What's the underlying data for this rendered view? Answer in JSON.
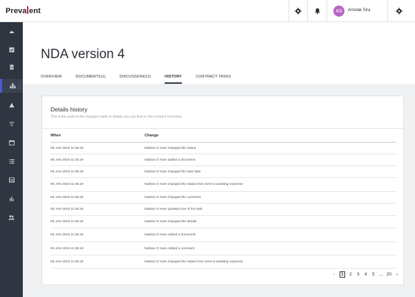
{
  "app": {
    "logo_left": "Preva",
    "logo_right": "ent"
  },
  "user": {
    "initials": "AS",
    "name": "Amolak Sira",
    "avatar_color": "#b864c4"
  },
  "sidebar": {
    "items": [
      {
        "icon": "dashboard-icon"
      },
      {
        "icon": "checkbox-icon"
      },
      {
        "icon": "document-icon"
      },
      {
        "icon": "org-chart-icon",
        "active": true
      },
      {
        "icon": "warning-icon"
      },
      {
        "icon": "filter-list-icon"
      },
      {
        "icon": "calendar-icon"
      },
      {
        "icon": "list-icon"
      },
      {
        "icon": "table-icon"
      },
      {
        "icon": "bar-chart-icon"
      },
      {
        "icon": "users-icon"
      }
    ]
  },
  "page": {
    "title": "NDA version 4",
    "tabs": [
      {
        "label": "OVERVIEW"
      },
      {
        "label": "DOCUMENTS(1)"
      },
      {
        "label": "DISCUSSION(12)"
      },
      {
        "label": "HISTORY",
        "active": true
      },
      {
        "label": "CONTRACT TASKS"
      }
    ]
  },
  "details": {
    "title": "Details history",
    "subtitle": "This is the audit of the changes made to details you can find on the contract Overview",
    "col_when": "When",
    "col_change": "Change",
    "rows": [
      {
        "when": "06 JAN 2019 11:38:19",
        "change": "Nathan O Hare changed the status"
      },
      {
        "when": "06 JAN 2019 11:38:19",
        "change": "Nathan O Hare added a document"
      },
      {
        "when": "06 JAN 2019 11:38:19",
        "change": "Nathan O Hare changed the start date"
      },
      {
        "when": "06 JAN 2019 11:38:19",
        "change": "Nathan O Hare changed the Status from Sent to awaiting response"
      },
      {
        "when": "06 JAN 2019 11:38:19",
        "change": "Nathan O Hare changed the comment"
      },
      {
        "when": "06 JAN 2019 11:38:19",
        "change": "Nathan O Hare updated one of the task"
      },
      {
        "when": "06 JAN 2019 11:38:19",
        "change": "Nathan O Hare changed the details"
      },
      {
        "when": "06 JAN 2019 11:38:19",
        "change": "Nathan O Hare Added a document"
      },
      {
        "when": "06 JAN 2019 11:38:19",
        "change": "Nathan O Hare Added a comment"
      },
      {
        "when": "06 JAN 2019 11:38:19",
        "change": "Nathan O Hare changed the Status from Sent to awaiting response"
      }
    ]
  },
  "pagination": {
    "prev": "‹",
    "pages": [
      "1",
      "2",
      "3",
      "4",
      "5"
    ],
    "ellipsis": "...",
    "last": "20",
    "next": "›",
    "current": "1"
  }
}
